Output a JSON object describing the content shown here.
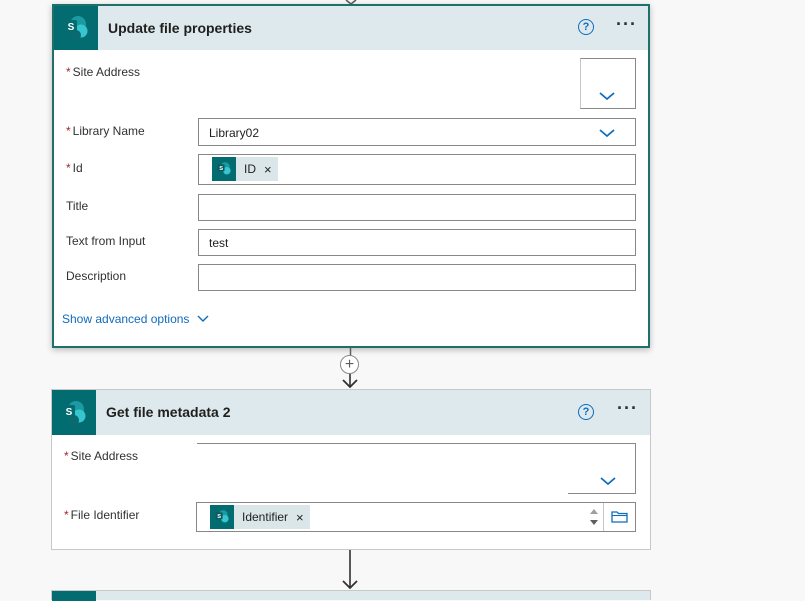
{
  "card1": {
    "title": "Update file properties",
    "help_label": "?",
    "more_label": "···",
    "fields": {
      "site_address": {
        "label": "Site Address",
        "required": "*"
      },
      "library_name": {
        "label": "Library Name",
        "required": "*",
        "value": "Library02"
      },
      "id": {
        "label": "Id",
        "required": "*",
        "token": "ID",
        "token_remove": "×"
      },
      "title": {
        "label": "Title"
      },
      "text_from_input": {
        "label": "Text from Input",
        "value": "test"
      },
      "description": {
        "label": "Description"
      }
    },
    "advanced_link": "Show advanced options"
  },
  "add_step_label": "+",
  "card2": {
    "title": "Get file metadata 2",
    "help_label": "?",
    "more_label": "···",
    "fields": {
      "site_address": {
        "label": "Site Address",
        "required": "*"
      },
      "file_identifier": {
        "label": "File Identifier",
        "required": "*",
        "token": "Identifier",
        "token_remove": "×"
      }
    }
  },
  "colors": {
    "accent": "#036c70",
    "header_bg": "#dde9ec",
    "link": "#0f6cbd",
    "required": "#a4262c"
  },
  "icons": [
    "sharepoint-icon",
    "help-icon",
    "more-icon",
    "chevron-down-icon",
    "close-icon",
    "folder-icon",
    "plus-icon",
    "arrow-down-icon"
  ]
}
